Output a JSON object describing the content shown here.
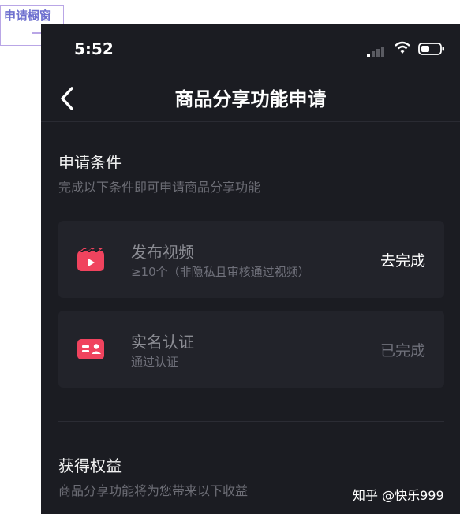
{
  "stamp": {
    "text": "申请橱窗"
  },
  "status_bar": {
    "time": "5:52"
  },
  "nav": {
    "title": "商品分享功能申请",
    "back_icon": "chevron-left-icon"
  },
  "conditions": {
    "title": "申请条件",
    "subtitle": "完成以下条件即可申请商品分享功能",
    "items": [
      {
        "title": "发布视频",
        "subtitle": "≥10个（非隐私且审核通过视频）",
        "action": "去完成",
        "icon": "video-clapper-icon"
      },
      {
        "title": "实名认证",
        "subtitle": "通过认证",
        "action": "已完成",
        "icon": "id-card-icon"
      }
    ]
  },
  "benefits": {
    "title": "获得权益",
    "subtitle": "商品分享功能将为您带来以下收益"
  },
  "watermark": "知乎 @快乐999",
  "colors": {
    "background": "#1b1c22",
    "card": "#22232a",
    "icon_accent": "#f0435e",
    "text_primary": "#ffffff",
    "text_muted": "#6f707a"
  }
}
